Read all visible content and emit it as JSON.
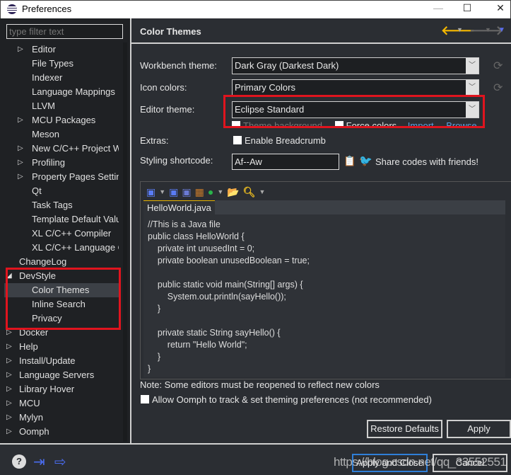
{
  "window": {
    "title": "Preferences",
    "minimize": "—",
    "maximize": "☐",
    "close": "✕"
  },
  "sidebar": {
    "filter_placeholder": "type filter text",
    "items": [
      {
        "label": "Editor",
        "level": 2,
        "arrow": "collapsed"
      },
      {
        "label": "File Types",
        "level": 2
      },
      {
        "label": "Indexer",
        "level": 2
      },
      {
        "label": "Language Mappings",
        "level": 2
      },
      {
        "label": "LLVM",
        "level": 2
      },
      {
        "label": "MCU Packages",
        "level": 2,
        "arrow": "collapsed"
      },
      {
        "label": "Meson",
        "level": 2
      },
      {
        "label": "New C/C++ Project Wizard",
        "level": 2,
        "arrow": "collapsed"
      },
      {
        "label": "Profiling",
        "level": 2,
        "arrow": "collapsed"
      },
      {
        "label": "Property Pages Settings",
        "level": 2,
        "arrow": "collapsed"
      },
      {
        "label": "Qt",
        "level": 2
      },
      {
        "label": "Task Tags",
        "level": 2
      },
      {
        "label": "Template Default Values",
        "level": 2
      },
      {
        "label": "XL C/C++ Compiler",
        "level": 2
      },
      {
        "label": "XL C/C++ Language Options",
        "level": 2
      },
      {
        "label": "ChangeLog",
        "level": 1
      },
      {
        "label": "DevStyle",
        "level": 1,
        "arrow": "expanded"
      },
      {
        "label": "Color Themes",
        "level": 2,
        "selected": true
      },
      {
        "label": "Inline Search",
        "level": 2
      },
      {
        "label": "Privacy",
        "level": 2
      },
      {
        "label": "Docker",
        "level": 1,
        "arrow": "collapsed"
      },
      {
        "label": "Help",
        "level": 1,
        "arrow": "collapsed"
      },
      {
        "label": "Install/Update",
        "level": 1,
        "arrow": "collapsed"
      },
      {
        "label": "Language Servers",
        "level": 1,
        "arrow": "collapsed"
      },
      {
        "label": "Library Hover",
        "level": 1,
        "arrow": "collapsed"
      },
      {
        "label": "MCU",
        "level": 1,
        "arrow": "collapsed"
      },
      {
        "label": "Mylyn",
        "level": 1,
        "arrow": "collapsed"
      },
      {
        "label": "Oomph",
        "level": 1,
        "arrow": "collapsed"
      }
    ]
  },
  "page": {
    "title": "Color Themes",
    "nav_icons": [
      "back-arrow-icon",
      "forward-arrow-icon",
      "view-menu-icon"
    ],
    "workbench_label": "Workbench theme:",
    "workbench_value": "Dark Gray (Darkest Dark)",
    "icon_label": "Icon colors:",
    "icon_value": "Primary Colors",
    "editor_label": "Editor theme:",
    "editor_value": "Eclipse Standard",
    "theme_bg": "Theme background",
    "force_colors": "Force colors",
    "import": "Import",
    "browse": "Browse",
    "extras_label": "Extras:",
    "breadcrumb": "Enable Breadcrumb",
    "shortcode_label": "Styling shortcode:",
    "shortcode_value": "Af--Aw",
    "share": "Share codes with friends!",
    "editor_tab": "HelloWorld.java",
    "code": "//This is a Java file\npublic class HelloWorld {\n    private int unusedInt = 0;\n    private boolean unusedBoolean = true;\n\n    public static void main(String[] args) {\n        System.out.println(sayHello());\n    }\n\n    private static String sayHello() {\n        return \"Hello World\";\n    }\n}",
    "note": "Note: Some editors must be reopened to reflect new colors",
    "oomph": "Allow Oomph to track & set theming preferences (not recommended)",
    "restore": "Restore Defaults",
    "apply": "Apply"
  },
  "footer": {
    "apply_close": "Apply and Close",
    "cancel": "Cancel",
    "watermark": "https://blog.csdn.net/qq_33552551"
  },
  "colors": {
    "highlight": "#e0141e",
    "accent": "#4a6cf0"
  }
}
